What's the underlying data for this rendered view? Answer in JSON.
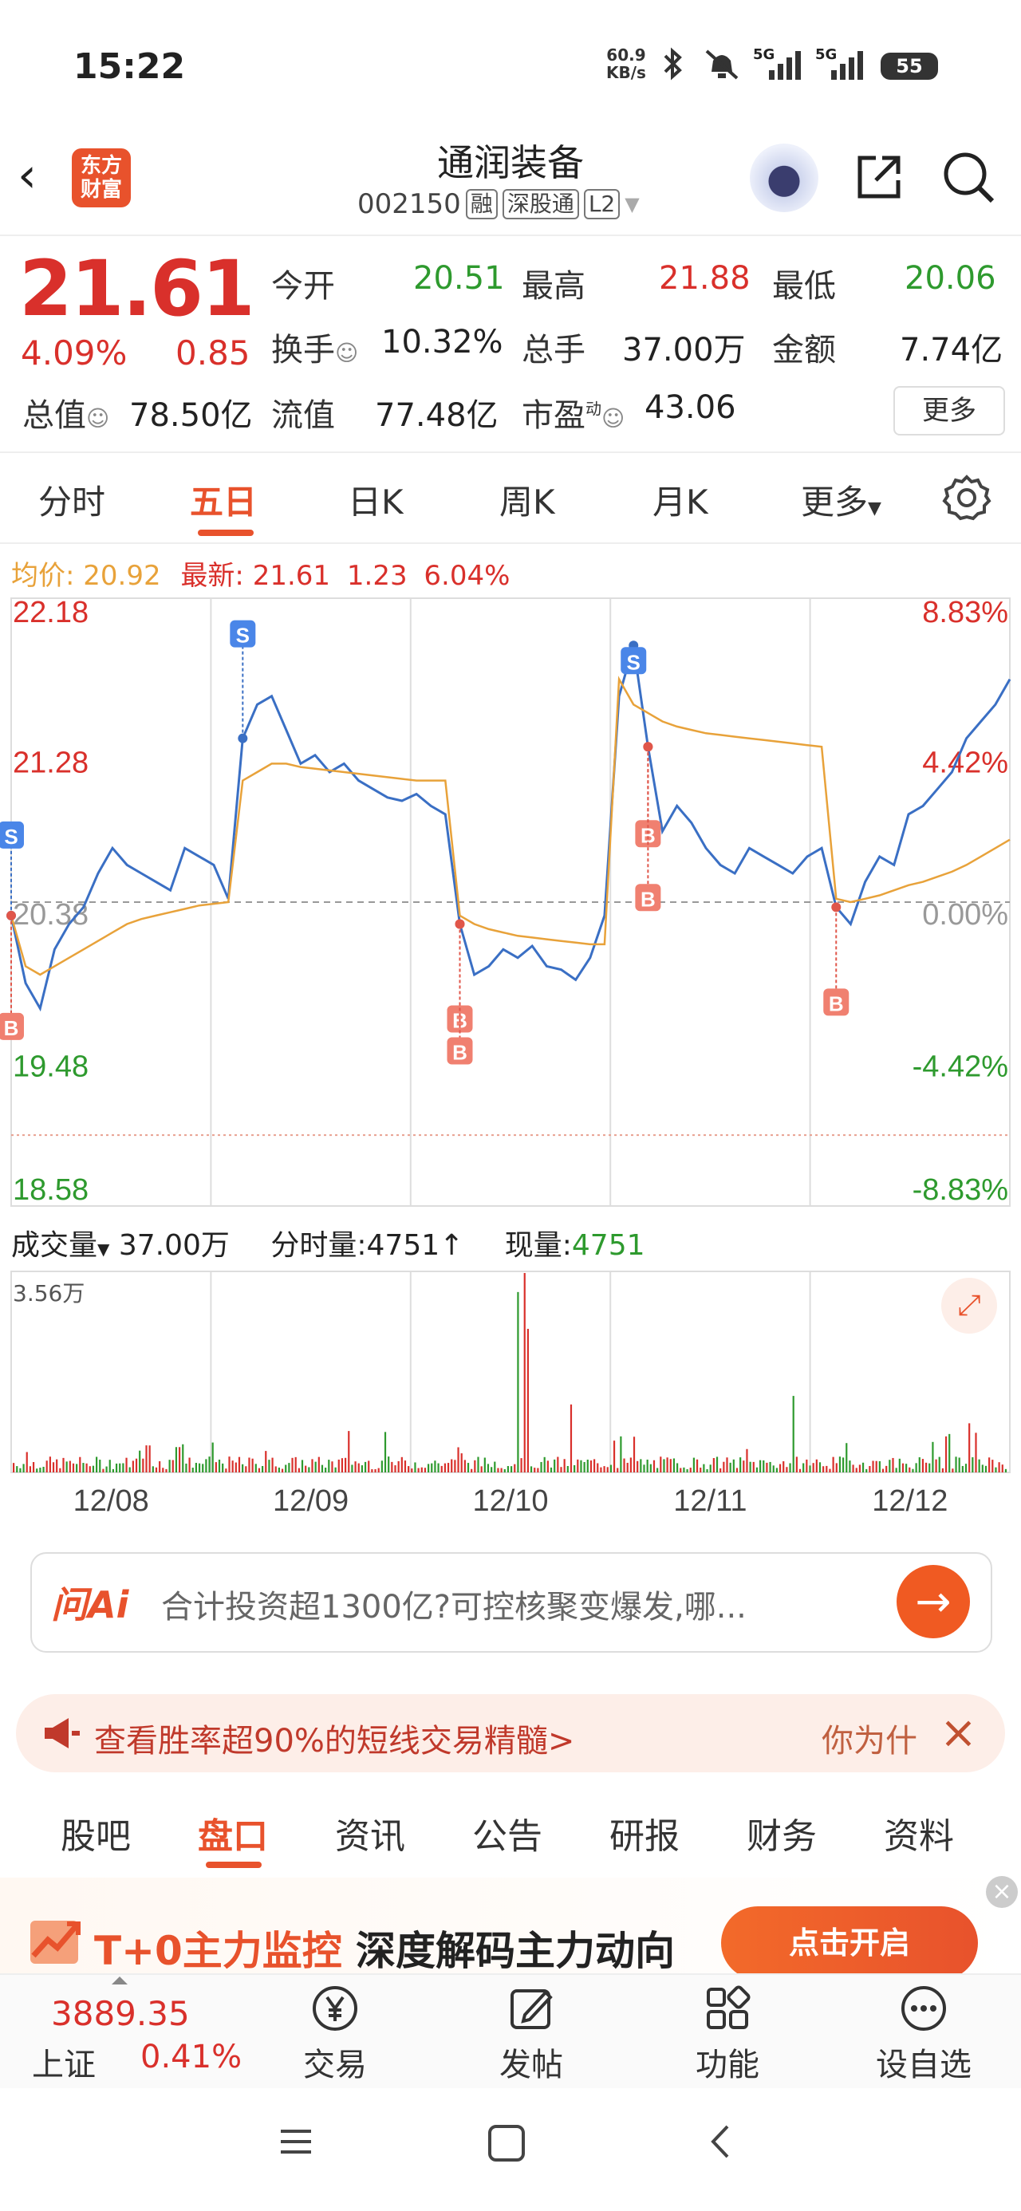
{
  "status_bar": {
    "time": "15:22",
    "net_speed_value": "60.9",
    "net_speed_unit": "KB/s",
    "signal1": "5G",
    "signal2": "5G",
    "battery": "55"
  },
  "header": {
    "logo_line1": "东方",
    "logo_line2": "财富",
    "title": "通润装备",
    "code": "002150",
    "tags": [
      "融",
      "深股通",
      "L2"
    ]
  },
  "quote": {
    "price": "21.61",
    "change_pct": "4.09%",
    "change": "0.85",
    "rows": [
      [
        {
          "label": "今开",
          "value": "20.51",
          "color": "green"
        },
        {
          "label": "最高",
          "value": "21.88",
          "color": "red"
        },
        {
          "label": "最低",
          "value": "20.06",
          "color": "green"
        }
      ],
      [
        {
          "label": "换手",
          "value": "10.32%",
          "color": "black"
        },
        {
          "label": "总手",
          "value": "37.00万",
          "color": "black"
        },
        {
          "label": "金额",
          "value": "7.74亿",
          "color": "black"
        }
      ],
      [
        {
          "label": "流值",
          "value": "77.48亿",
          "color": "black"
        },
        {
          "label": "市盈",
          "value": "43.06",
          "color": "black"
        }
      ]
    ],
    "total_value_label": "总值",
    "total_value": "78.50亿",
    "pe_sup": "动",
    "more_label": "更多"
  },
  "chart_tabs": [
    "分时",
    "五日",
    "日K",
    "周K",
    "月K",
    "更多"
  ],
  "active_chart_tab": "五日",
  "avg_row": {
    "avg_label": "均价:",
    "avg_value": "20.92",
    "latest_label": "最新:",
    "latest_value": "21.61",
    "latest_change": "1.23",
    "latest_pct": "6.04%"
  },
  "volume_row": {
    "label": "成交量",
    "total": "37.00万",
    "tick_label": "分时量:",
    "tick_value": "4751",
    "now_label": "现量:",
    "now_value": "4751",
    "max_label": "3.56万"
  },
  "chart_data": {
    "type": "line",
    "title": "",
    "price_ticks": [
      "22.18",
      "21.28",
      "20.38",
      "19.48",
      "18.58"
    ],
    "pct_ticks": [
      "8.83%",
      "4.42%",
      "0.00%",
      "-4.42%",
      "-8.83%"
    ],
    "ylim": [
      18.58,
      22.18
    ],
    "prev_close": 20.38,
    "x_labels": [
      "12/08",
      "12/09",
      "12/10",
      "12/11",
      "12/12"
    ],
    "series": [
      {
        "name": "",
        "color": "#3a6fc4",
        "values": [
          20.3,
          19.9,
          19.75,
          20.1,
          20.25,
          20.35,
          20.55,
          20.7,
          20.6,
          20.55,
          20.5,
          20.45,
          20.7,
          20.65,
          20.6,
          20.4,
          21.35,
          21.55,
          21.6,
          21.4,
          21.2,
          21.25,
          21.15,
          21.2,
          21.1,
          21.05,
          21.0,
          20.98,
          21.02,
          20.95,
          20.9,
          20.25,
          19.95,
          20.0,
          20.1,
          20.05,
          20.12,
          20.0,
          19.98,
          19.92,
          20.05,
          20.3,
          21.6,
          21.9,
          21.3,
          20.8,
          20.95,
          20.85,
          20.7,
          20.6,
          20.55,
          20.7,
          20.65,
          20.6,
          20.55,
          20.65,
          20.7,
          20.35,
          20.25,
          20.5,
          20.65,
          20.6,
          20.9,
          20.95,
          21.05,
          21.15,
          21.35,
          21.45,
          21.55,
          21.7
        ]
      },
      {
        "name": "",
        "color": "#e8a23a",
        "values": [
          20.3,
          20.0,
          19.95,
          20.0,
          20.05,
          20.1,
          20.15,
          20.2,
          20.25,
          20.28,
          20.3,
          20.32,
          20.34,
          20.36,
          20.37,
          20.38,
          21.1,
          21.15,
          21.2,
          21.2,
          21.18,
          21.17,
          21.16,
          21.15,
          21.14,
          21.13,
          21.12,
          21.11,
          21.1,
          21.1,
          21.1,
          20.3,
          20.25,
          20.22,
          20.2,
          20.18,
          20.17,
          20.16,
          20.15,
          20.14,
          20.13,
          20.13,
          21.7,
          21.55,
          21.5,
          21.45,
          21.42,
          21.4,
          21.38,
          21.37,
          21.36,
          21.35,
          21.34,
          21.33,
          21.32,
          21.31,
          21.3,
          20.4,
          20.38,
          20.4,
          20.42,
          20.45,
          20.48,
          20.5,
          20.53,
          20.56,
          20.6,
          20.65,
          20.7,
          20.75
        ]
      }
    ],
    "volume": {
      "max": "3.56万",
      "spikes": [
        0.05,
        0.08,
        0.06,
        0.1,
        0.12,
        0.25,
        0.08,
        0.06,
        0.2,
        0.1,
        0.07,
        0.05,
        1.0,
        0.3,
        0.15,
        0.1,
        0.08,
        0.06,
        0.35,
        0.12,
        0.1,
        0.08,
        0.15,
        0.2
      ]
    },
    "markers": {
      "buy": "B",
      "sell": "S"
    }
  },
  "ai": {
    "logo": "问Ai",
    "text": "合计投资超1300亿?可控核聚变爆发,哪..."
  },
  "promo": {
    "text": "查看胜率超90%的短线交易精髓>",
    "right": "你为什"
  },
  "bottom_tabs": [
    "股吧",
    "盘口",
    "资讯",
    "公告",
    "研报",
    "财务",
    "资料"
  ],
  "active_bottom_tab": "盘口",
  "banner": {
    "red": "T+0主力监控",
    "black": "深度解码主力动向",
    "button": "点击开启"
  },
  "index": {
    "value": "3889.35",
    "name": "上证",
    "pct": "0.41%"
  },
  "nav": [
    "交易",
    "发帖",
    "功能",
    "设自选"
  ]
}
